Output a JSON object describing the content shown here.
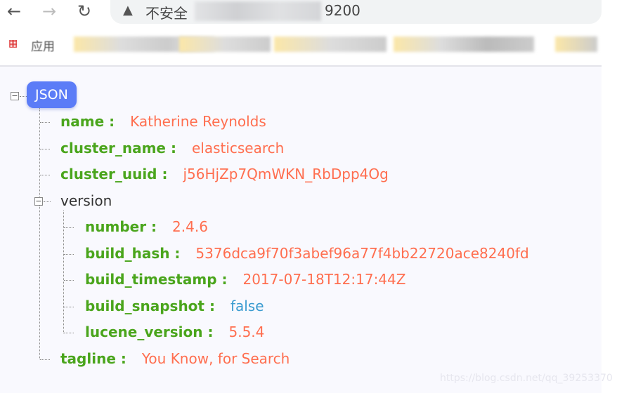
{
  "browser": {
    "back_icon": "←",
    "forward_icon": "→",
    "reload_icon": "↻",
    "warning_icon": "▲",
    "address_prefix": "不安全",
    "address_suffix": "9200",
    "bookmark_apps": "应用"
  },
  "tree": {
    "root_label": "JSON",
    "items": [
      {
        "key": "name :",
        "value": "Katherine Reynolds",
        "type": "string"
      },
      {
        "key": "cluster_name :",
        "value": "elasticsearch",
        "type": "string"
      },
      {
        "key": "cluster_uuid :",
        "value": "j56HjZp7QmWKN_RbDpp4Og",
        "type": "string"
      }
    ],
    "version": {
      "label": "version",
      "items": [
        {
          "key": "number :",
          "value": "2.4.6",
          "type": "string"
        },
        {
          "key": "build_hash :",
          "value": "5376dca9f70f3abef96a77f4bb22720ace8240fd",
          "type": "string"
        },
        {
          "key": "build_timestamp :",
          "value": "2017-07-18T12:17:44Z",
          "type": "string"
        },
        {
          "key": "build_snapshot :",
          "value": "false",
          "type": "boolean"
        },
        {
          "key": "lucene_version :",
          "value": "5.5.4",
          "type": "string"
        }
      ]
    },
    "tagline": {
      "key": "tagline :",
      "value": "You Know, for Search"
    }
  },
  "colors": {
    "key": "#4aa51c",
    "string": "#ff6e4f",
    "boolean": "#3a9bd0",
    "root": "#5b7cf7"
  },
  "watermark": "https://blog.csdn.net/qq_39253370"
}
